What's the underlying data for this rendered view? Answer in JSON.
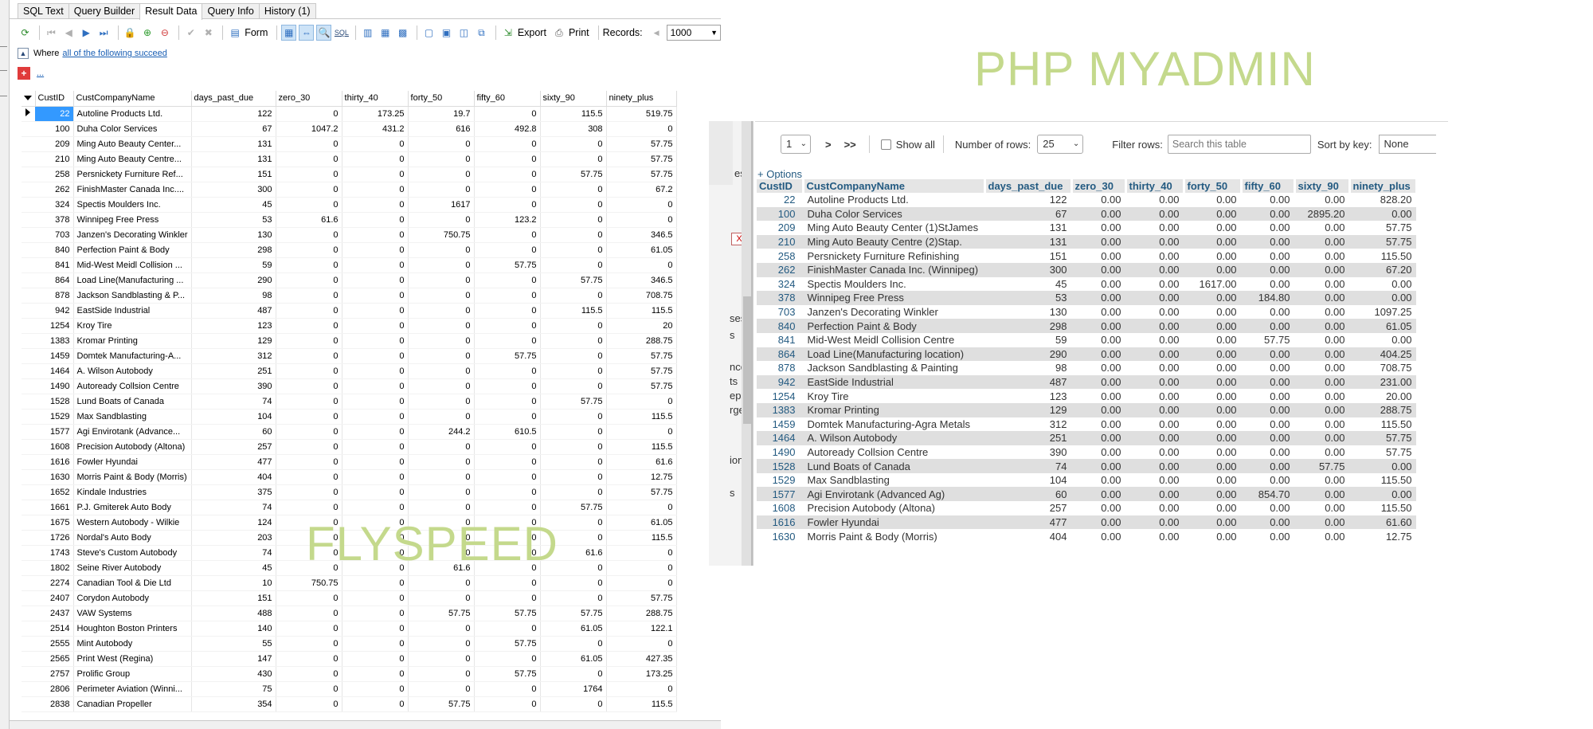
{
  "flyspeed": {
    "tabs": [
      "SQL Text",
      "Query Builder",
      "Result Data",
      "Query Info",
      "History (1)"
    ],
    "active_tab": "Result Data",
    "toolbar": {
      "form_label": "Form",
      "sql_label": "SQL",
      "export_label": "Export",
      "print_label": "Print",
      "records_label": "Records:",
      "records_value": "1000"
    },
    "filter": {
      "where_label": "Where",
      "condition_link": "all of the following succeed",
      "add_link": "..."
    },
    "columns": [
      "CustID",
      "CustCompanyName",
      "days_past_due",
      "zero_30",
      "thirty_40",
      "forty_50",
      "fifty_60",
      "sixty_90",
      "ninety_plus"
    ],
    "rows": [
      [
        "22",
        "Autoline Products Ltd.",
        "122",
        "0",
        "173.25",
        "19.7",
        "0",
        "115.5",
        "519.75"
      ],
      [
        "100",
        "Duha Color Services",
        "67",
        "1047.2",
        "431.2",
        "616",
        "492.8",
        "308",
        "0"
      ],
      [
        "209",
        "Ming Auto Beauty Center...",
        "131",
        "0",
        "0",
        "0",
        "0",
        "0",
        "57.75"
      ],
      [
        "210",
        "Ming Auto Beauty Centre...",
        "131",
        "0",
        "0",
        "0",
        "0",
        "0",
        "57.75"
      ],
      [
        "258",
        "Persnickety Furniture Ref...",
        "151",
        "0",
        "0",
        "0",
        "0",
        "57.75",
        "57.75"
      ],
      [
        "262",
        "FinishMaster Canada Inc....",
        "300",
        "0",
        "0",
        "0",
        "0",
        "0",
        "67.2"
      ],
      [
        "324",
        "Spectis Moulders Inc.",
        "45",
        "0",
        "0",
        "1617",
        "0",
        "0",
        "0"
      ],
      [
        "378",
        "Winnipeg Free Press",
        "53",
        "61.6",
        "0",
        "0",
        "123.2",
        "0",
        "0"
      ],
      [
        "703",
        "Janzen's Decorating Winkler",
        "130",
        "0",
        "0",
        "750.75",
        "0",
        "0",
        "346.5"
      ],
      [
        "840",
        "Perfection Paint & Body",
        "298",
        "0",
        "0",
        "0",
        "0",
        "0",
        "61.05"
      ],
      [
        "841",
        "Mid-West Meidl Collision ...",
        "59",
        "0",
        "0",
        "0",
        "57.75",
        "0",
        "0"
      ],
      [
        "864",
        "Load Line(Manufacturing ...",
        "290",
        "0",
        "0",
        "0",
        "0",
        "57.75",
        "346.5"
      ],
      [
        "878",
        "Jackson Sandblasting & P...",
        "98",
        "0",
        "0",
        "0",
        "0",
        "0",
        "708.75"
      ],
      [
        "942",
        "EastSide Industrial",
        "487",
        "0",
        "0",
        "0",
        "0",
        "115.5",
        "115.5"
      ],
      [
        "1254",
        "Kroy Tire",
        "123",
        "0",
        "0",
        "0",
        "0",
        "0",
        "20"
      ],
      [
        "1383",
        "Kromar Printing",
        "129",
        "0",
        "0",
        "0",
        "0",
        "0",
        "288.75"
      ],
      [
        "1459",
        "Domtek Manufacturing-A...",
        "312",
        "0",
        "0",
        "0",
        "57.75",
        "0",
        "57.75"
      ],
      [
        "1464",
        "A. Wilson Autobody",
        "251",
        "0",
        "0",
        "0",
        "0",
        "0",
        "57.75"
      ],
      [
        "1490",
        "Autoready Collsion Centre",
        "390",
        "0",
        "0",
        "0",
        "0",
        "0",
        "57.75"
      ],
      [
        "1528",
        "Lund Boats of Canada",
        "74",
        "0",
        "0",
        "0",
        "0",
        "57.75",
        "0"
      ],
      [
        "1529",
        "Max Sandblasting",
        "104",
        "0",
        "0",
        "0",
        "0",
        "0",
        "115.5"
      ],
      [
        "1577",
        "Agi Envirotank (Advance...",
        "60",
        "0",
        "0",
        "244.2",
        "610.5",
        "0",
        "0"
      ],
      [
        "1608",
        "Precision Autobody (Altona)",
        "257",
        "0",
        "0",
        "0",
        "0",
        "0",
        "115.5"
      ],
      [
        "1616",
        "Fowler Hyundai",
        "477",
        "0",
        "0",
        "0",
        "0",
        "0",
        "61.6"
      ],
      [
        "1630",
        "Morris Paint & Body (Morris)",
        "404",
        "0",
        "0",
        "0",
        "0",
        "0",
        "12.75"
      ],
      [
        "1652",
        "Kindale Industries",
        "375",
        "0",
        "0",
        "0",
        "0",
        "0",
        "57.75"
      ],
      [
        "1661",
        "P.J. Gmiterek Auto Body",
        "74",
        "0",
        "0",
        "0",
        "0",
        "57.75",
        "0"
      ],
      [
        "1675",
        "Western Autobody - Wilkie",
        "124",
        "0",
        "0",
        "0",
        "0",
        "0",
        "61.05"
      ],
      [
        "1726",
        "Nordal's Auto Body",
        "203",
        "0",
        "0",
        "0",
        "0",
        "0",
        "115.5"
      ],
      [
        "1743",
        "Steve's Custom Autobody",
        "74",
        "0",
        "0",
        "0",
        "0",
        "61.6",
        "0"
      ],
      [
        "1802",
        "Seine River Autobody",
        "45",
        "0",
        "0",
        "61.6",
        "0",
        "0",
        "0"
      ],
      [
        "2274",
        "Canadian Tool & Die Ltd",
        "10",
        "750.75",
        "0",
        "0",
        "0",
        "0",
        "0"
      ],
      [
        "2407",
        "Corydon Autobody",
        "151",
        "0",
        "0",
        "0",
        "0",
        "0",
        "57.75"
      ],
      [
        "2437",
        "VAW Systems",
        "488",
        "0",
        "0",
        "57.75",
        "57.75",
        "57.75",
        "288.75"
      ],
      [
        "2514",
        "Houghton Boston Printers",
        "140",
        "0",
        "0",
        "0",
        "0",
        "61.05",
        "122.1"
      ],
      [
        "2555",
        "Mint Autobody",
        "55",
        "0",
        "0",
        "0",
        "57.75",
        "0",
        "0"
      ],
      [
        "2565",
        "Print West (Regina)",
        "147",
        "0",
        "0",
        "0",
        "0",
        "61.05",
        "427.35"
      ],
      [
        "2757",
        "Prolific Group",
        "430",
        "0",
        "0",
        "0",
        "57.75",
        "0",
        "173.25"
      ],
      [
        "2806",
        "Perimeter Aviation (Winni...",
        "75",
        "0",
        "0",
        "0",
        "0",
        "1764",
        "0"
      ],
      [
        "2838",
        "Canadian Propeller",
        "354",
        "0",
        "0",
        "57.75",
        "0",
        "0",
        "115.5"
      ]
    ],
    "watermark": "FLYSPEED"
  },
  "phpmyadmin": {
    "watermark": "PHP MYADMIN",
    "nav": {
      "page_value": "1",
      "next": ">",
      "last": ">>",
      "show_all": "Show all",
      "rows_label": "Number of rows:",
      "rows_value": "25",
      "filter_label": "Filter rows:",
      "filter_placeholder": "Search this table",
      "sort_label": "Sort by key:",
      "sort_value": "None"
    },
    "sidebar_fragments": [
      "es",
      "X",
      "ses",
      "s",
      "nces",
      "ts",
      "eps",
      "rges",
      "ions",
      "s"
    ],
    "options_link": "+ Options",
    "columns": [
      "CustID",
      "CustCompanyName",
      "days_past_due",
      "zero_30",
      "thirty_40",
      "forty_50",
      "fifty_60",
      "sixty_90",
      "ninety_plus"
    ],
    "rows": [
      [
        "22",
        "Autoline Products Ltd.",
        "122",
        "0.00",
        "0.00",
        "0.00",
        "0.00",
        "0.00",
        "828.20"
      ],
      [
        "100",
        "Duha Color Services",
        "67",
        "0.00",
        "0.00",
        "0.00",
        "0.00",
        "2895.20",
        "0.00"
      ],
      [
        "209",
        "Ming Auto Beauty Center (1)StJames",
        "131",
        "0.00",
        "0.00",
        "0.00",
        "0.00",
        "0.00",
        "57.75"
      ],
      [
        "210",
        "Ming Auto Beauty Centre (2)Stap.",
        "131",
        "0.00",
        "0.00",
        "0.00",
        "0.00",
        "0.00",
        "57.75"
      ],
      [
        "258",
        "Persnickety Furniture Refinishing",
        "151",
        "0.00",
        "0.00",
        "0.00",
        "0.00",
        "0.00",
        "115.50"
      ],
      [
        "262",
        "FinishMaster Canada Inc. (Winnipeg)",
        "300",
        "0.00",
        "0.00",
        "0.00",
        "0.00",
        "0.00",
        "67.20"
      ],
      [
        "324",
        "Spectis Moulders Inc.",
        "45",
        "0.00",
        "0.00",
        "1617.00",
        "0.00",
        "0.00",
        "0.00"
      ],
      [
        "378",
        "Winnipeg Free Press",
        "53",
        "0.00",
        "0.00",
        "0.00",
        "184.80",
        "0.00",
        "0.00"
      ],
      [
        "703",
        "Janzen's Decorating Winkler",
        "130",
        "0.00",
        "0.00",
        "0.00",
        "0.00",
        "0.00",
        "1097.25"
      ],
      [
        "840",
        "Perfection Paint & Body",
        "298",
        "0.00",
        "0.00",
        "0.00",
        "0.00",
        "0.00",
        "61.05"
      ],
      [
        "841",
        "Mid-West Meidl Collision Centre",
        "59",
        "0.00",
        "0.00",
        "0.00",
        "57.75",
        "0.00",
        "0.00"
      ],
      [
        "864",
        "Load Line(Manufacturing location)",
        "290",
        "0.00",
        "0.00",
        "0.00",
        "0.00",
        "0.00",
        "404.25"
      ],
      [
        "878",
        "Jackson Sandblasting & Painting",
        "98",
        "0.00",
        "0.00",
        "0.00",
        "0.00",
        "0.00",
        "708.75"
      ],
      [
        "942",
        "EastSide Industrial",
        "487",
        "0.00",
        "0.00",
        "0.00",
        "0.00",
        "0.00",
        "231.00"
      ],
      [
        "1254",
        "Kroy Tire",
        "123",
        "0.00",
        "0.00",
        "0.00",
        "0.00",
        "0.00",
        "20.00"
      ],
      [
        "1383",
        "Kromar Printing",
        "129",
        "0.00",
        "0.00",
        "0.00",
        "0.00",
        "0.00",
        "288.75"
      ],
      [
        "1459",
        "Domtek Manufacturing-Agra Metals",
        "312",
        "0.00",
        "0.00",
        "0.00",
        "0.00",
        "0.00",
        "115.50"
      ],
      [
        "1464",
        "A. Wilson Autobody",
        "251",
        "0.00",
        "0.00",
        "0.00",
        "0.00",
        "0.00",
        "57.75"
      ],
      [
        "1490",
        "Autoready Collsion Centre",
        "390",
        "0.00",
        "0.00",
        "0.00",
        "0.00",
        "0.00",
        "57.75"
      ],
      [
        "1528",
        "Lund Boats of Canada",
        "74",
        "0.00",
        "0.00",
        "0.00",
        "0.00",
        "57.75",
        "0.00"
      ],
      [
        "1529",
        "Max Sandblasting",
        "104",
        "0.00",
        "0.00",
        "0.00",
        "0.00",
        "0.00",
        "115.50"
      ],
      [
        "1577",
        "Agi Envirotank (Advanced Ag)",
        "60",
        "0.00",
        "0.00",
        "0.00",
        "854.70",
        "0.00",
        "0.00"
      ],
      [
        "1608",
        "Precision Autobody (Altona)",
        "257",
        "0.00",
        "0.00",
        "0.00",
        "0.00",
        "0.00",
        "115.50"
      ],
      [
        "1616",
        "Fowler Hyundai",
        "477",
        "0.00",
        "0.00",
        "0.00",
        "0.00",
        "0.00",
        "61.60"
      ],
      [
        "1630",
        "Morris Paint & Body (Morris)",
        "404",
        "0.00",
        "0.00",
        "0.00",
        "0.00",
        "0.00",
        "12.75"
      ]
    ]
  }
}
